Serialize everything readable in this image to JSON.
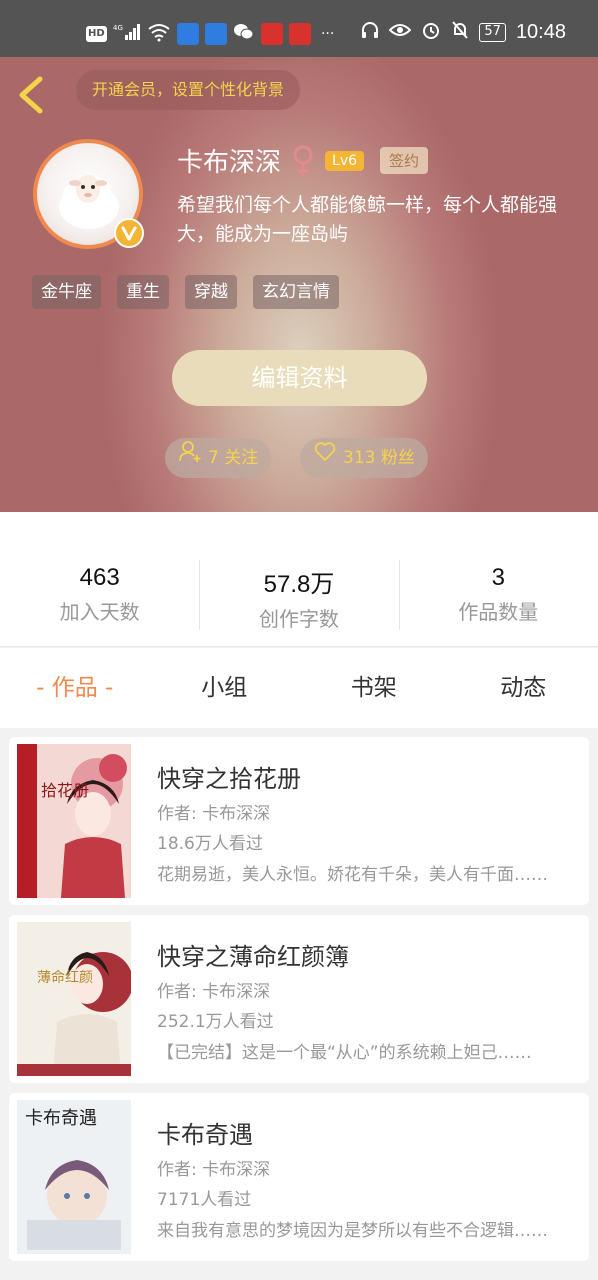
{
  "status_bar": {
    "left_icons": [
      "HD",
      "4G-signal-icon",
      "wifi-icon",
      "app-icon",
      "app-icon",
      "wechat-icon",
      "app-icon",
      "app-icon",
      "more-icon"
    ],
    "hd_label": "HD",
    "more_label": "···",
    "battery": "57",
    "time": "10:48"
  },
  "header": {
    "vip_prompt": "开通会员，设置个性化背景",
    "username": "卡布深深",
    "level": "Lv6",
    "signed_tag": "签约",
    "bio": "希望我们每个人都能像鲸一样，每个人都能强大，能成为一座岛屿",
    "tags": [
      "金牛座",
      "重生",
      "穿越",
      "玄幻言情"
    ],
    "edit_button": "编辑资料",
    "following": "7 关注",
    "followers": "313 粉丝"
  },
  "stats": [
    {
      "value": "463",
      "label": "加入天数"
    },
    {
      "value": "57.8万",
      "label": "创作字数"
    },
    {
      "value": "3",
      "label": "作品数量"
    }
  ],
  "tabs": [
    {
      "label": "- 作品 -",
      "active": true
    },
    {
      "label": "小组",
      "active": false
    },
    {
      "label": "书架",
      "active": false
    },
    {
      "label": "动态",
      "active": false
    }
  ],
  "books": [
    {
      "title": "快穿之拾花册",
      "author": "作者: 卡布深深",
      "views": "18.6万人看过",
      "desc": "花期易逝，美人永恒。娇花有千朵，美人有千面……",
      "cover_text": "拾花册"
    },
    {
      "title": "快穿之薄命红颜簿",
      "author": "作者: 卡布深深",
      "views": "252.1万人看过",
      "desc": "【已完结】这是一个最“从心”的系统赖上妲己……",
      "cover_text": "薄命红颜"
    },
    {
      "title": "卡布奇遇",
      "author": "作者: 卡布深深",
      "views": "7171人看过",
      "desc": "来自我有意思的梦境因为是梦所以有些不合逻辑……",
      "cover_text": "卡布奇遇"
    }
  ],
  "colors": {
    "accent_orange": "#f0894e",
    "gold": "#f6d34c",
    "status_bar": "#545454"
  }
}
